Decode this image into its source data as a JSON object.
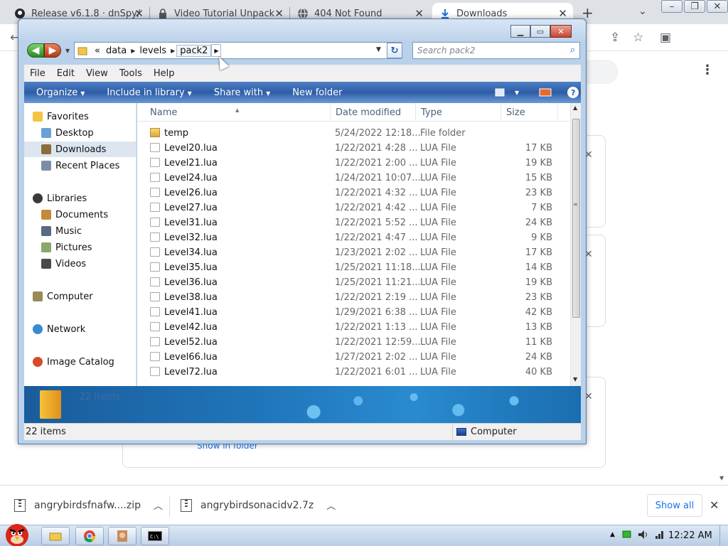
{
  "browser": {
    "tabs": [
      {
        "label": "Release v6.1.8 · dnSpy/",
        "icon": "github-icon",
        "active": false
      },
      {
        "label": "Video Tutorial Unpack",
        "icon": "lock-icon",
        "active": false
      },
      {
        "label": "404 Not Found",
        "icon": "globe-icon",
        "active": false
      },
      {
        "label": "Downloads",
        "icon": "download-icon",
        "active": true
      }
    ],
    "new_tab_label": "+",
    "tab_close_label": "✕",
    "page_link": "Show in folder",
    "download_items": [
      {
        "label": "angrybirdsfnafw....zip"
      },
      {
        "label": "angrybirdsonacidv2.7z"
      }
    ],
    "show_all_label": "Show all"
  },
  "explorer": {
    "nav_back_icon": "back-arrow-icon",
    "nav_forward_icon": "forward-arrow-icon",
    "address": {
      "overflow": "«",
      "segments": [
        "data",
        "levels",
        "pack2"
      ]
    },
    "search_placeholder": "Search pack2",
    "menu": [
      "File",
      "Edit",
      "View",
      "Tools",
      "Help"
    ],
    "commands": [
      "Organize",
      "Include in library",
      "Share with",
      "New folder"
    ],
    "nav_pane": {
      "favorites": {
        "label": "Favorites",
        "items": [
          "Desktop",
          "Downloads",
          "Recent Places"
        ]
      },
      "libraries": {
        "label": "Libraries",
        "items": [
          "Documents",
          "Music",
          "Pictures",
          "Videos"
        ]
      },
      "computer": "Computer",
      "network": "Network",
      "image_catalog": "Image Catalog",
      "selected": "Downloads"
    },
    "columns": {
      "name": "Name",
      "date": "Date modified",
      "type": "Type",
      "size": "Size"
    },
    "files": [
      {
        "name": "temp",
        "date": "5/24/2022 12:18...",
        "type": "File folder",
        "size": "",
        "kind": "folder"
      },
      {
        "name": "Level20.lua",
        "date": "1/22/2021 4:28 ...",
        "type": "LUA File",
        "size": "17 KB",
        "kind": "file"
      },
      {
        "name": "Level21.lua",
        "date": "1/22/2021 2:00 ...",
        "type": "LUA File",
        "size": "19 KB",
        "kind": "file"
      },
      {
        "name": "Level24.lua",
        "date": "1/24/2021 10:07...",
        "type": "LUA File",
        "size": "15 KB",
        "kind": "file"
      },
      {
        "name": "Level26.lua",
        "date": "1/22/2021 4:32 ...",
        "type": "LUA File",
        "size": "23 KB",
        "kind": "file"
      },
      {
        "name": "Level27.lua",
        "date": "1/22/2021 4:42 ...",
        "type": "LUA File",
        "size": "7 KB",
        "kind": "file"
      },
      {
        "name": "Level31.lua",
        "date": "1/22/2021 5:52 ...",
        "type": "LUA File",
        "size": "24 KB",
        "kind": "file"
      },
      {
        "name": "Level32.lua",
        "date": "1/22/2021 4:47 ...",
        "type": "LUA File",
        "size": "9 KB",
        "kind": "file"
      },
      {
        "name": "Level34.lua",
        "date": "1/23/2021 2:02 ...",
        "type": "LUA File",
        "size": "17 KB",
        "kind": "file"
      },
      {
        "name": "Level35.lua",
        "date": "1/25/2021 11:18...",
        "type": "LUA File",
        "size": "14 KB",
        "kind": "file"
      },
      {
        "name": "Level36.lua",
        "date": "1/25/2021 11:21...",
        "type": "LUA File",
        "size": "19 KB",
        "kind": "file"
      },
      {
        "name": "Level38.lua",
        "date": "1/22/2021 2:19 ...",
        "type": "LUA File",
        "size": "23 KB",
        "kind": "file"
      },
      {
        "name": "Level41.lua",
        "date": "1/29/2021 6:38 ...",
        "type": "LUA File",
        "size": "42 KB",
        "kind": "file"
      },
      {
        "name": "Level42.lua",
        "date": "1/22/2021 1:13 ...",
        "type": "LUA File",
        "size": "13 KB",
        "kind": "file"
      },
      {
        "name": "Level52.lua",
        "date": "1/22/2021 12:59...",
        "type": "LUA File",
        "size": "11 KB",
        "kind": "file"
      },
      {
        "name": "Level66.lua",
        "date": "1/27/2021 2:02 ...",
        "type": "LUA File",
        "size": "24 KB",
        "kind": "file"
      },
      {
        "name": "Level72.lua",
        "date": "1/22/2021 6:01 ...",
        "type": "LUA File",
        "size": "40 KB",
        "kind": "file"
      }
    ],
    "details_count": "22 items",
    "status_left": "22 items",
    "status_right": "Computer"
  },
  "taskbar": {
    "clock": "12:22 AM"
  },
  "colors": {
    "cmdbar": "#2d5da6",
    "link": "#1a73e8",
    "tab_strip": "#dee1e6"
  }
}
